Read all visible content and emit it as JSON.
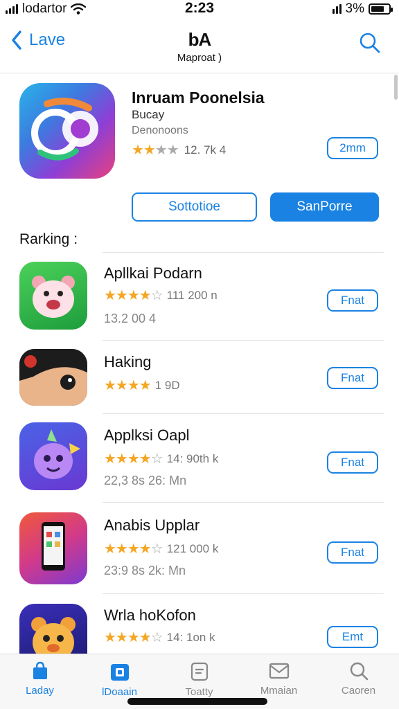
{
  "status_bar": {
    "carrier": "lodartor",
    "time": "2:23",
    "battery": "3%"
  },
  "nav": {
    "back_label": "Lave",
    "logo": "bA",
    "subtitle": "Maproat )"
  },
  "featured": {
    "title": "Inruam Poonelsia",
    "developer": "Bucay",
    "category": "Denonoons",
    "rating_text": "12. 7k 4",
    "get_label": "2mm",
    "secondary_button": "Sottotioe",
    "primary_button": "SanPorre"
  },
  "section": {
    "title": "Rarking :"
  },
  "apps": [
    {
      "name": "Apllkai Podarn",
      "rating_text": "111 200 n",
      "size": "13.2 00 4",
      "get_label": "Fnat",
      "icon": "pig-icon"
    },
    {
      "name": "Haking",
      "rating_text": "1 9D",
      "size": "",
      "get_label": "Fnat",
      "icon": "anime-face-icon"
    },
    {
      "name": "Applksi Oapl",
      "rating_text": "14: 90th k",
      "size": "22,3 8s 26: Mn",
      "get_label": "Fnat",
      "icon": "purple-creature-icon"
    },
    {
      "name": "Anabis Upplar",
      "rating_text": "121 000 k",
      "size": "23:9 8s 2k: Mn",
      "get_label": "Fnat",
      "icon": "phone-icon"
    },
    {
      "name": "Wrla hoKofon",
      "rating_text": "14: 1on k",
      "size": "",
      "get_label": "Emt",
      "icon": "bear-icon"
    }
  ],
  "tabs": [
    {
      "label": "Laday",
      "icon": "bag-icon",
      "active": true
    },
    {
      "label": "lDoaain",
      "icon": "apps-icon",
      "active": true
    },
    {
      "label": "Toatty",
      "icon": "games-icon",
      "active": false
    },
    {
      "label": "Mmaian",
      "icon": "mail-icon",
      "active": false
    },
    {
      "label": "Caoren",
      "icon": "search-icon",
      "active": false
    }
  ],
  "colors": {
    "accent": "#1a82e2",
    "star": "#f5a623"
  }
}
